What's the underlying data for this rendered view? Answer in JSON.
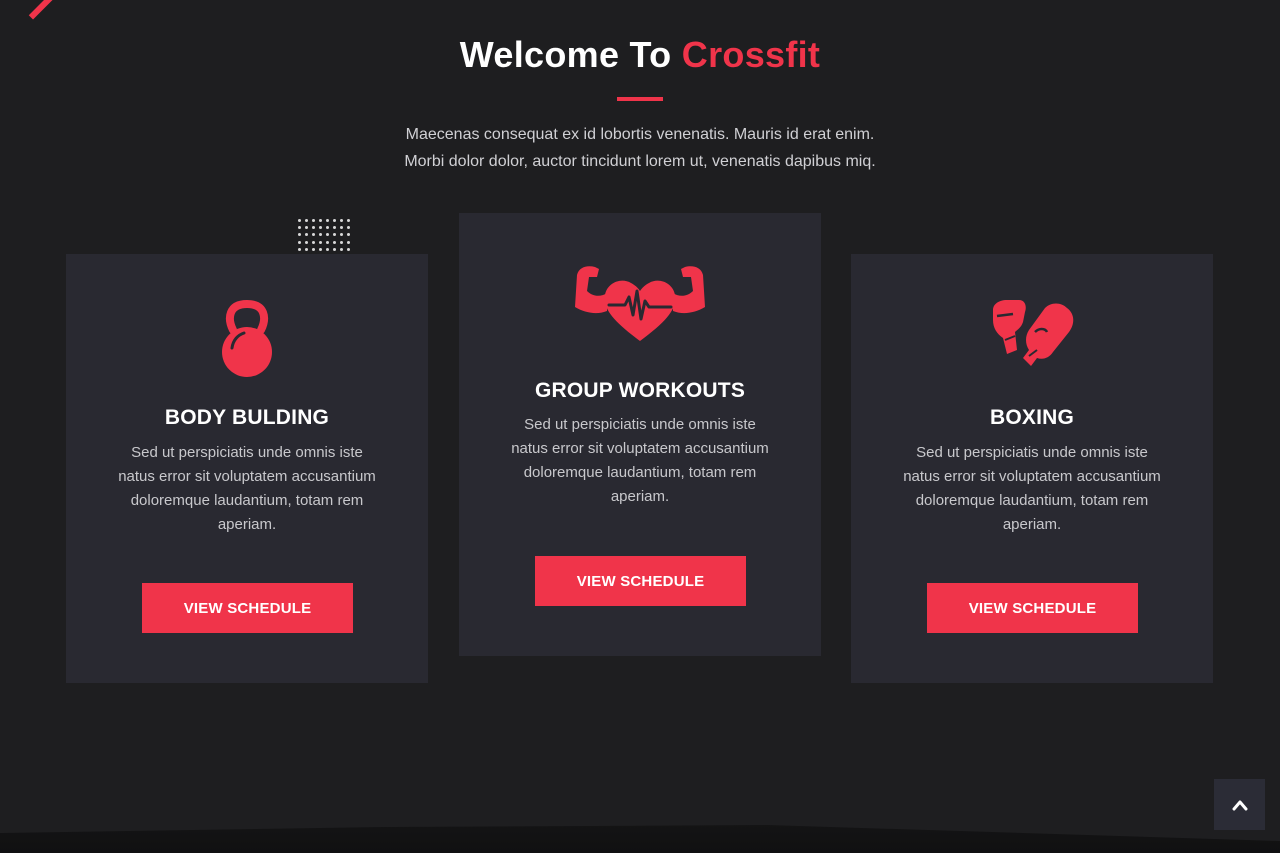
{
  "section": {
    "title_prefix": "Welcome To",
    "title_accent": "Crossfit",
    "intro_line1": "Maecenas consequat ex id lobortis venenatis. Mauris id erat enim.",
    "intro_line2": "Morbi dolor dolor, auctor tincidunt lorem ut, venenatis dapibus miq."
  },
  "cards": [
    {
      "icon": "kettlebell-icon",
      "title": "BODY BULDING",
      "description": "Sed ut perspiciatis unde omnis iste natus error sit voluptatem accusantium doloremque laudantium, totam rem aperiam.",
      "button_label": "VIEW SCHEDULE"
    },
    {
      "icon": "heart-muscle-icon",
      "title": "GROUP WORKOUTS",
      "description": "Sed ut perspiciatis unde omnis iste natus error sit voluptatem accusantium doloremque laudantium, totam rem aperiam.",
      "button_label": "VIEW SCHEDULE"
    },
    {
      "icon": "boxing-gloves-icon",
      "title": "BOXING",
      "description": "Sed ut perspiciatis unde omnis iste natus error sit voluptatem accusantium doloremque laudantium, totam rem aperiam.",
      "button_label": "VIEW SCHEDULE"
    }
  ],
  "scroll_top": {
    "icon": "chevron-up-icon"
  },
  "colors": {
    "accent": "#f0344a",
    "background": "#1e1e20",
    "card": "#292931"
  }
}
